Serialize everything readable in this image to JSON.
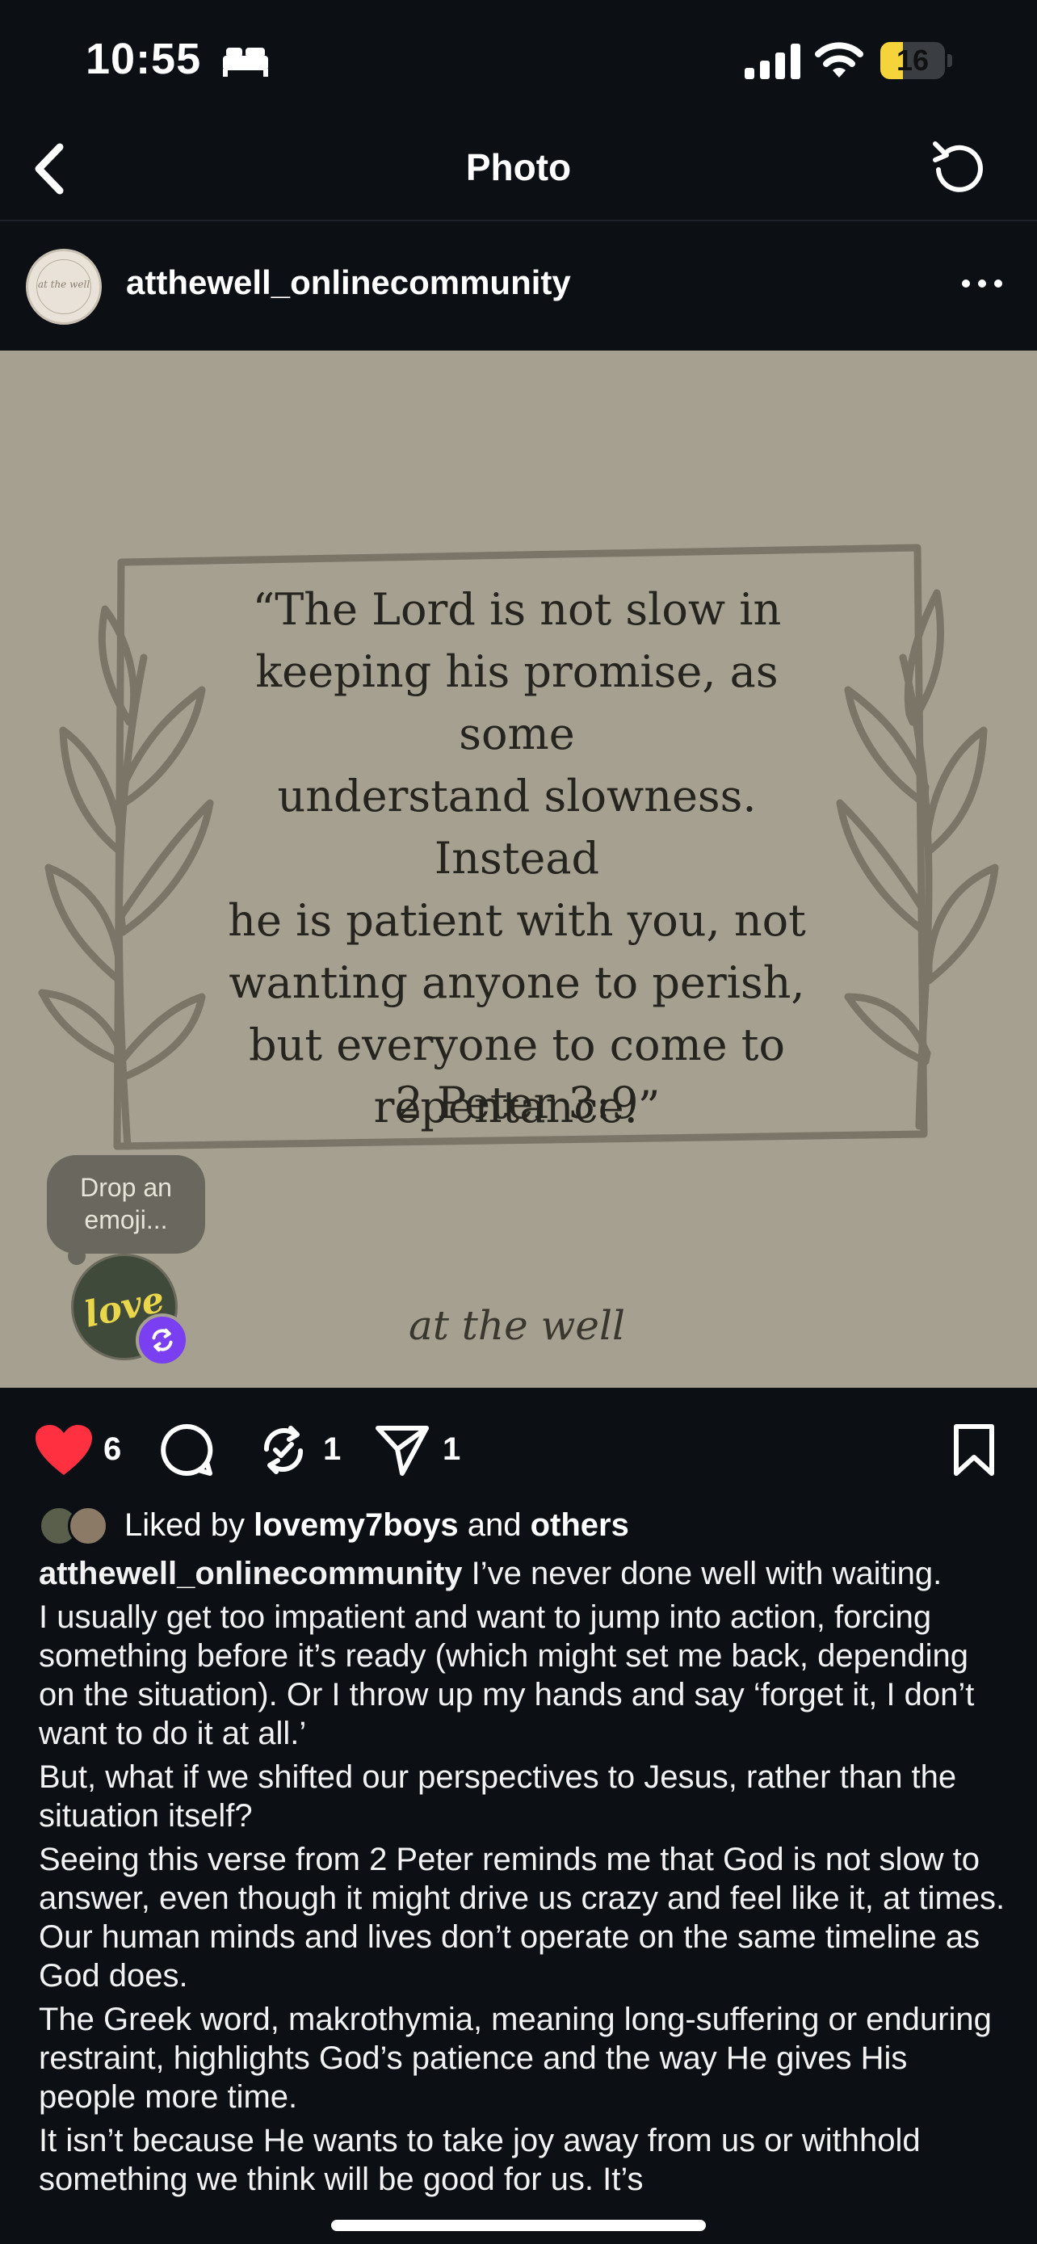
{
  "status_bar": {
    "time": "10:55",
    "battery_level": "16",
    "battery_percent": 16,
    "icons": [
      "bed-icon",
      "signal-icon",
      "wifi-icon",
      "battery-icon"
    ]
  },
  "nav": {
    "title": "Photo",
    "back_icon": "chevron-left-icon",
    "refresh_icon": "refresh-icon"
  },
  "post": {
    "username": "atthewell_onlinecommunity",
    "avatar_text": "at the well",
    "more_icon": "ellipsis-icon"
  },
  "image": {
    "quote_lines": [
      "“The Lord is not slow in",
      "keeping his promise, as some",
      "understand slowness. Instead",
      "he is patient with you, not",
      "wanting anyone to perish,",
      "but everyone to come to",
      "repentance.”"
    ],
    "reference": "2 Peter 3:9",
    "signature": "at the well",
    "emoji_prompt": "Drop an emoji...",
    "repost_avatar_text": "love",
    "background_color": "#a5a090",
    "ink_color": "#7a7566"
  },
  "actions": {
    "like_count": "6",
    "repost_count": "1",
    "share_count": "1",
    "like_color": "#ff3040"
  },
  "liked_by": {
    "prefix": "Liked by",
    "user": "lovemy7boys",
    "connector": "and",
    "others": "others"
  },
  "caption": {
    "owner": "atthewell_onlinecommunity",
    "first_text": "I’ve never done well with waiting.",
    "paragraphs": [
      "I usually get too impatient and want to jump into action, forcing something before it’s ready (which might set me back, depending on the situation). Or I throw up my hands and say ‘forget it, I don’t want to do it at all.’",
      "But, what if we shifted our perspectives to Jesus, rather than the situation itself?",
      "Seeing this verse from 2 Peter reminds me that God is not slow to answer, even though it might drive us crazy and feel like it, at times. Our human minds and lives don’t operate on the same timeline as God does.",
      "The Greek word, makrothymia, meaning long-suffering or enduring restraint, highlights God’s patience and the way He gives His people more time.",
      "It isn’t because He wants to take joy away from us or withhold something we think will be good for us. It’s"
    ]
  }
}
